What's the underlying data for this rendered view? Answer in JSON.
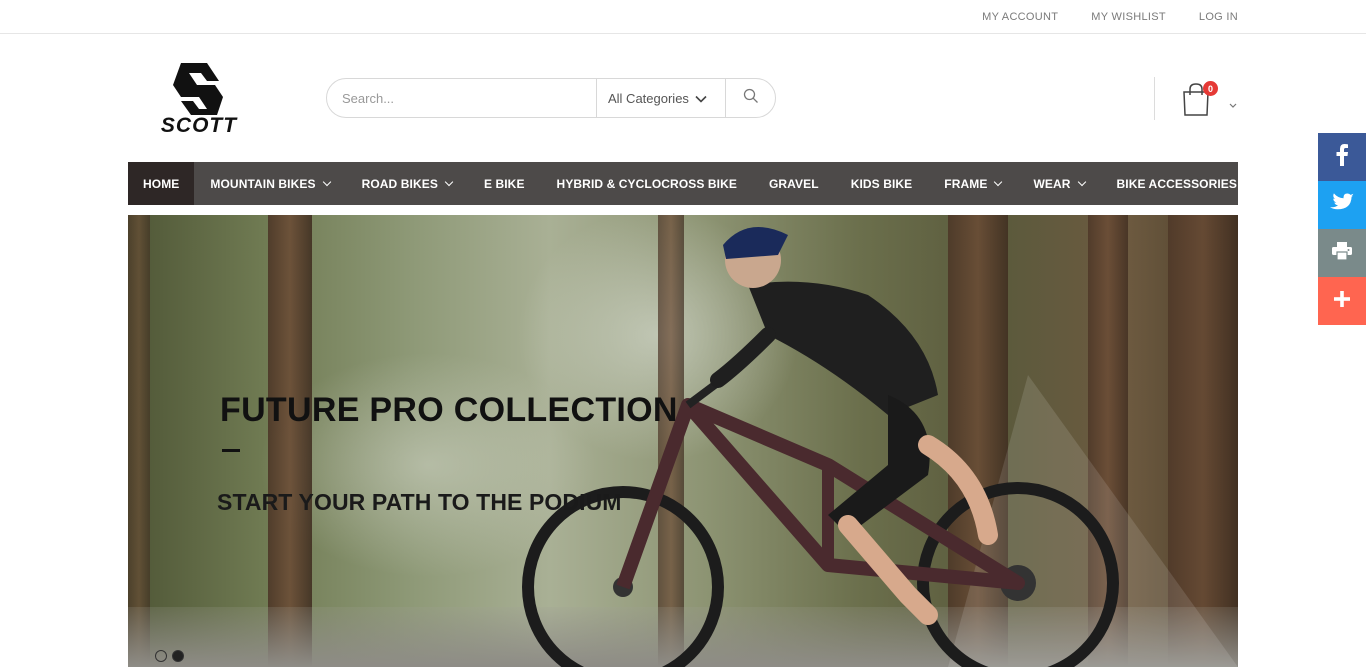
{
  "topbar": {
    "links": [
      "MY ACCOUNT",
      "MY WISHLIST",
      "LOG IN"
    ]
  },
  "brand": {
    "logo_text": "SCOTT"
  },
  "search": {
    "placeholder": "Search...",
    "category": "All Categories"
  },
  "cart": {
    "count": "0"
  },
  "nav": {
    "items": [
      {
        "label": "HOME",
        "active": true,
        "dropdown": false
      },
      {
        "label": "MOUNTAIN BIKES",
        "dropdown": true
      },
      {
        "label": "ROAD BIKES",
        "dropdown": true
      },
      {
        "label": "E BIKE",
        "dropdown": false
      },
      {
        "label": "HYBRID & CYCLOCROSS BIKE",
        "dropdown": false
      },
      {
        "label": "GRAVEL",
        "dropdown": false
      },
      {
        "label": "KIDS BIKE",
        "dropdown": false
      },
      {
        "label": "FRAME",
        "dropdown": true
      },
      {
        "label": "WEAR",
        "dropdown": true
      },
      {
        "label": "BIKE ACCESSORIES",
        "dropdown": true
      }
    ]
  },
  "hero": {
    "title": "FUTURE PRO COLLECTION",
    "subtitle": "START YOUR PATH TO THE PODIUM",
    "slides": 2,
    "active_slide": 2
  },
  "share": {
    "items": [
      {
        "name": "facebook",
        "color": "#3b5998"
      },
      {
        "name": "twitter",
        "color": "#1da1f2"
      },
      {
        "name": "print",
        "color": "#7a8a8a"
      },
      {
        "name": "more",
        "color": "#ff6550"
      }
    ]
  }
}
